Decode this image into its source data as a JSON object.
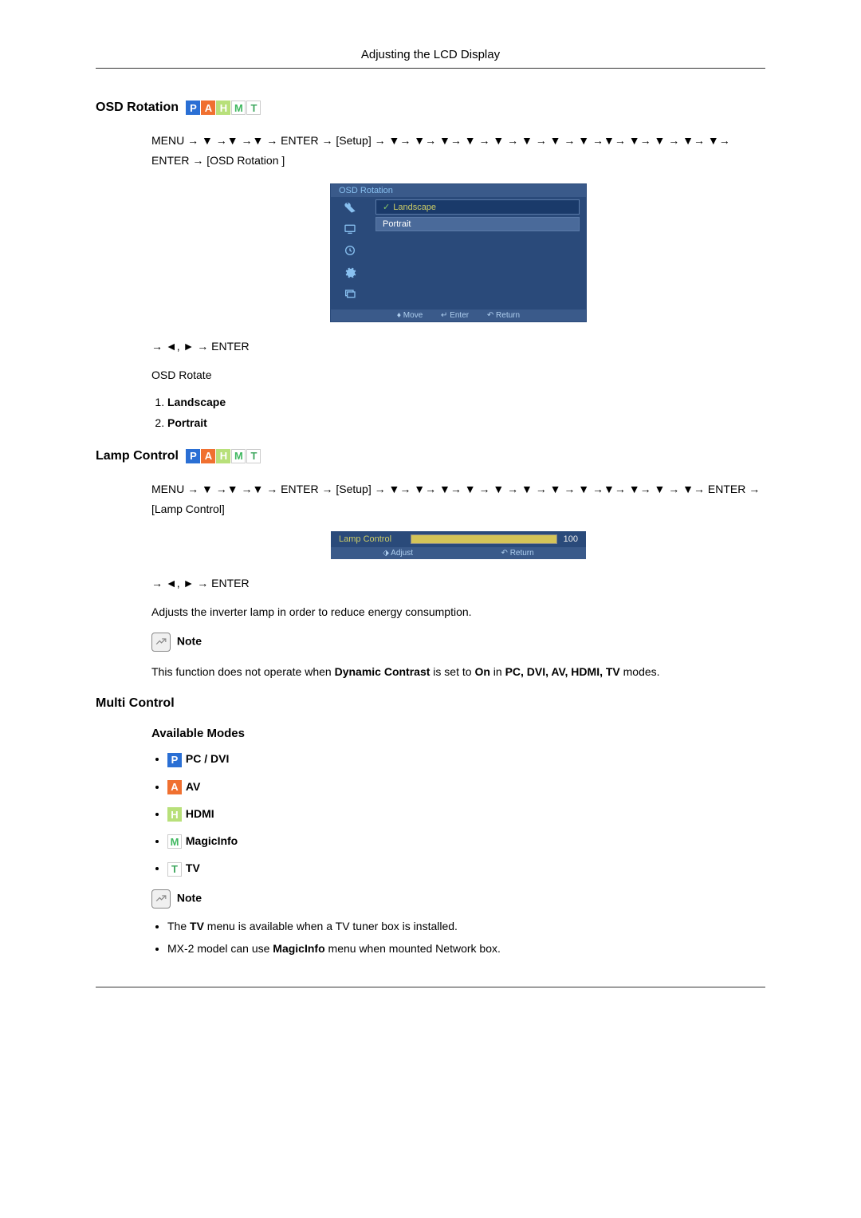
{
  "header": "Adjusting the LCD Display",
  "section1": {
    "title": "OSD Rotation",
    "nav": "MENU → ▼ →▼ →▼ → ENTER → [Setup] → ▼→ ▼→ ▼→ ▼ → ▼ → ▼ → ▼ → ▼ →▼→ ▼→ ▼ → ▼→ ▼→ ENTER → [OSD Rotation ]",
    "osd_title": "OSD Rotation",
    "osd_opt1": "Landscape",
    "osd_opt2": "Portrait",
    "osd_footer_move": "♦ Move",
    "osd_footer_enter": "↵ Enter",
    "osd_footer_return": "↶ Return",
    "nav2": "→ ◄, ► → ENTER",
    "rotate_label": "OSD Rotate",
    "opt1": "Landscape",
    "opt2": "Portrait"
  },
  "section2": {
    "title": "Lamp Control",
    "nav": "MENU → ▼ →▼ →▼ → ENTER → [Setup] → ▼→ ▼→ ▼→ ▼ → ▼ → ▼ → ▼ → ▼ →▼→ ▼→ ▼ → ▼→ ENTER → [Lamp Control]",
    "osd_label": "Lamp Control",
    "osd_value": "100",
    "osd_adjust": "⬗ Adjust",
    "osd_return": "↶ Return",
    "nav2": "→ ◄, ► → ENTER",
    "desc": "Adjusts the inverter lamp in order to reduce energy consumption.",
    "note_label": "Note",
    "note_pre": "This function does not operate when ",
    "note_dc": "Dynamic Contrast",
    "note_mid": " is set to ",
    "note_on": "On",
    "note_in": " in ",
    "note_modes": "PC, DVI, AV, HDMI, TV",
    "note_end": " modes."
  },
  "section3": {
    "title": "Multi Control",
    "subtitle": "Available Modes",
    "mode1": "PC / DVI",
    "mode2": "AV",
    "mode3": "HDMI",
    "mode4": "MagicInfo",
    "mode5": "TV",
    "note_label": "Note",
    "note1_pre": "The ",
    "note1_tv": "TV",
    "note1_post": " menu is available when a TV tuner box is installed.",
    "note2_pre": "MX-2 model can use ",
    "note2_mi": "MagicInfo",
    "note2_post": " menu when mounted Network box."
  },
  "icons": {
    "p": "P",
    "a": "A",
    "h": "H",
    "m": "M",
    "t": "T"
  }
}
